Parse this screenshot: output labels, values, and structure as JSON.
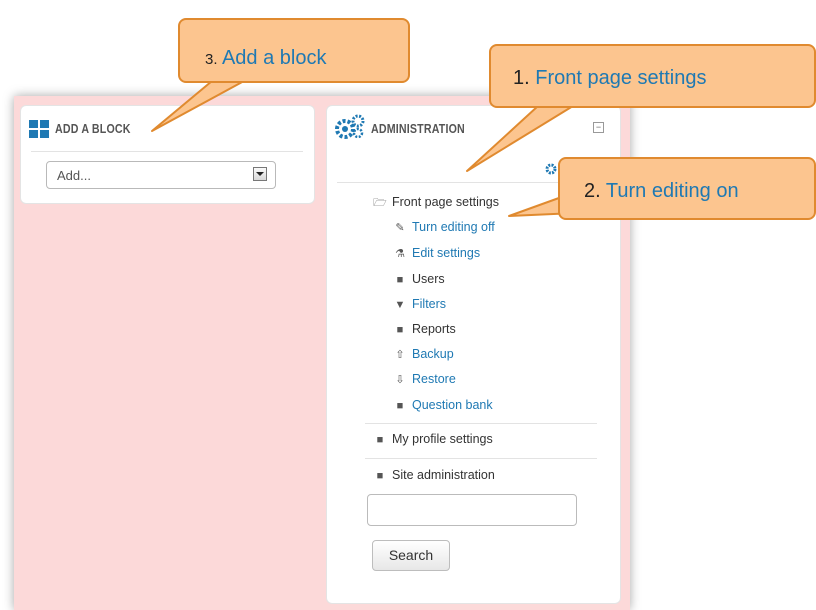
{
  "add_block": {
    "title": "ADD A BLOCK",
    "select_value": "Add..."
  },
  "administration": {
    "title": "ADMINISTRATION",
    "front_page_settings": "Front page settings",
    "items": [
      {
        "label": "Turn editing off",
        "icon": "pencil-icon"
      },
      {
        "label": "Edit settings",
        "icon": "flask-icon"
      },
      {
        "label": "Users",
        "icon": "folder-icon"
      },
      {
        "label": "Filters",
        "icon": "filter-icon"
      },
      {
        "label": "Reports",
        "icon": "folder-icon"
      },
      {
        "label": "Backup",
        "icon": "upload-icon"
      },
      {
        "label": "Restore",
        "icon": "download-icon"
      },
      {
        "label": "Question bank",
        "icon": "folder-icon"
      }
    ],
    "my_profile_settings": "My profile settings",
    "site_administration": "Site administration",
    "search_value": "",
    "search_button": "Search"
  },
  "callouts": {
    "c3_num": "3.",
    "c3_text": "Add a block",
    "c1_num": "1.",
    "c1_text": "Front page settings",
    "c2_num": "2.",
    "c2_text": "Turn editing on"
  },
  "colors": {
    "link": "#1f79b3",
    "page_bg": "#fcd9d9",
    "callout_fill": "#fcc58f",
    "callout_border": "#e08a2f"
  }
}
